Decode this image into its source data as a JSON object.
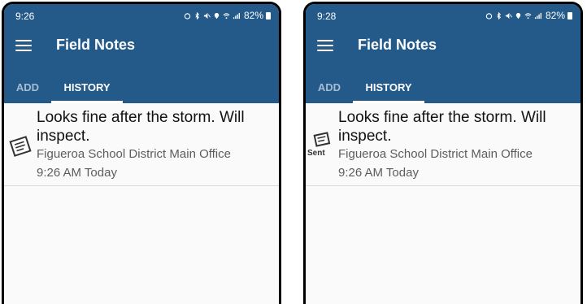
{
  "screens": [
    {
      "status": {
        "time": "9:26",
        "battery": "82%"
      },
      "app_title": "Field Notes",
      "tabs": [
        "ADD",
        "HISTORY"
      ],
      "note": {
        "text": "Looks fine after the storm. Will inspect.",
        "location": "Figueroa School District Main Office",
        "timestamp": "9:26 AM Today",
        "icon": "note-icon"
      }
    },
    {
      "status": {
        "time": "9:28",
        "battery": "82%"
      },
      "app_title": "Field Notes",
      "tabs": [
        "ADD",
        "HISTORY"
      ],
      "note": {
        "text": "Looks fine after the storm. Will inspect.",
        "location": "Figueroa School District Main Office",
        "timestamp": "9:26 AM Today",
        "icon": "sent-note-icon",
        "sent_label": "Sent"
      }
    }
  ],
  "colors": {
    "app_bar": "#235a8a",
    "active_tab": "#ffffff",
    "inactive_tab": "#a8bdd2"
  }
}
